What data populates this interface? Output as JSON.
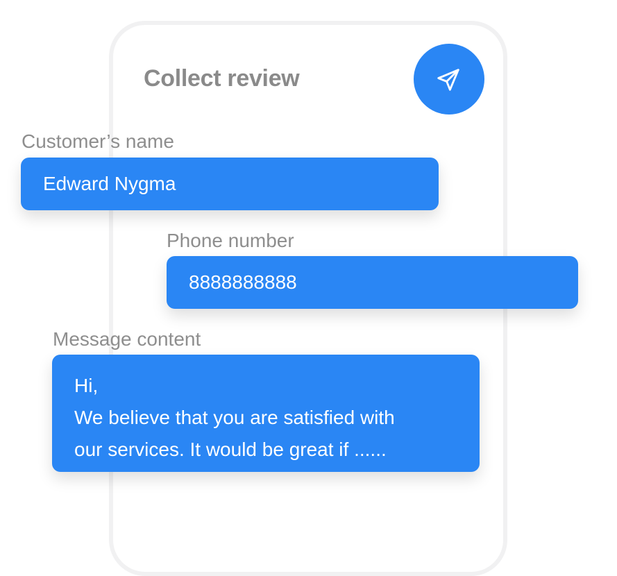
{
  "card": {
    "title": "Collect review"
  },
  "send_button": {
    "icon": "send-icon",
    "color": "#2a86f4"
  },
  "fields": {
    "customer_name": {
      "label": "Customer’s name",
      "value": "Edward Nygma"
    },
    "phone_number": {
      "label": "Phone number",
      "value": "8888888888"
    },
    "message_content": {
      "label": "Message content",
      "lines": [
        "Hi,",
        "We believe that you are satisfied with",
        "our services. It would be great if ......"
      ]
    }
  },
  "colors": {
    "accent": "#2a86f4",
    "label_text": "#8e8e8e",
    "frame_border": "#f1f1f2"
  }
}
